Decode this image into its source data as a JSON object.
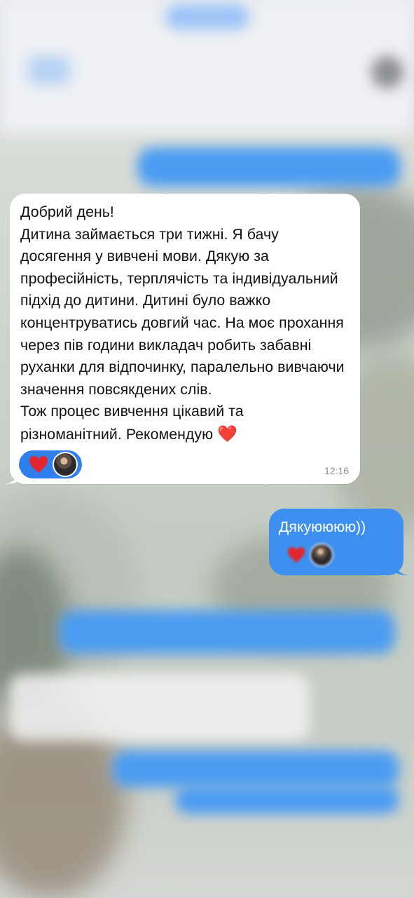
{
  "chat": {
    "incoming_message": {
      "text": "Добрий день!\nДитина займається три тижні. Я бачу досягення у вивчені мови. Дякую за професійність, терплячість та індивідуальний підхід до дитини. Дитині було важко концентруватись довгий час. На моє прохання через пів години викладач робить забавні руханки для відпочинку, паралельно вивчаючи значення повсякдених слів.\nТож процес вивчення цікавий та різноманітний. Рекомендую",
      "emoji": "❤️",
      "time": "12:16",
      "reaction_icon": "heart-icon"
    },
    "outgoing_message": {
      "text": "Дякуюююю))",
      "reaction_icon": "heart-icon"
    }
  },
  "colors": {
    "incoming_bubble": "#ffffff",
    "outgoing_bubble": "#3d8ff0",
    "reaction_pill": "#2f80ed",
    "heart": "#e3262e",
    "time": "#8b8f96"
  }
}
